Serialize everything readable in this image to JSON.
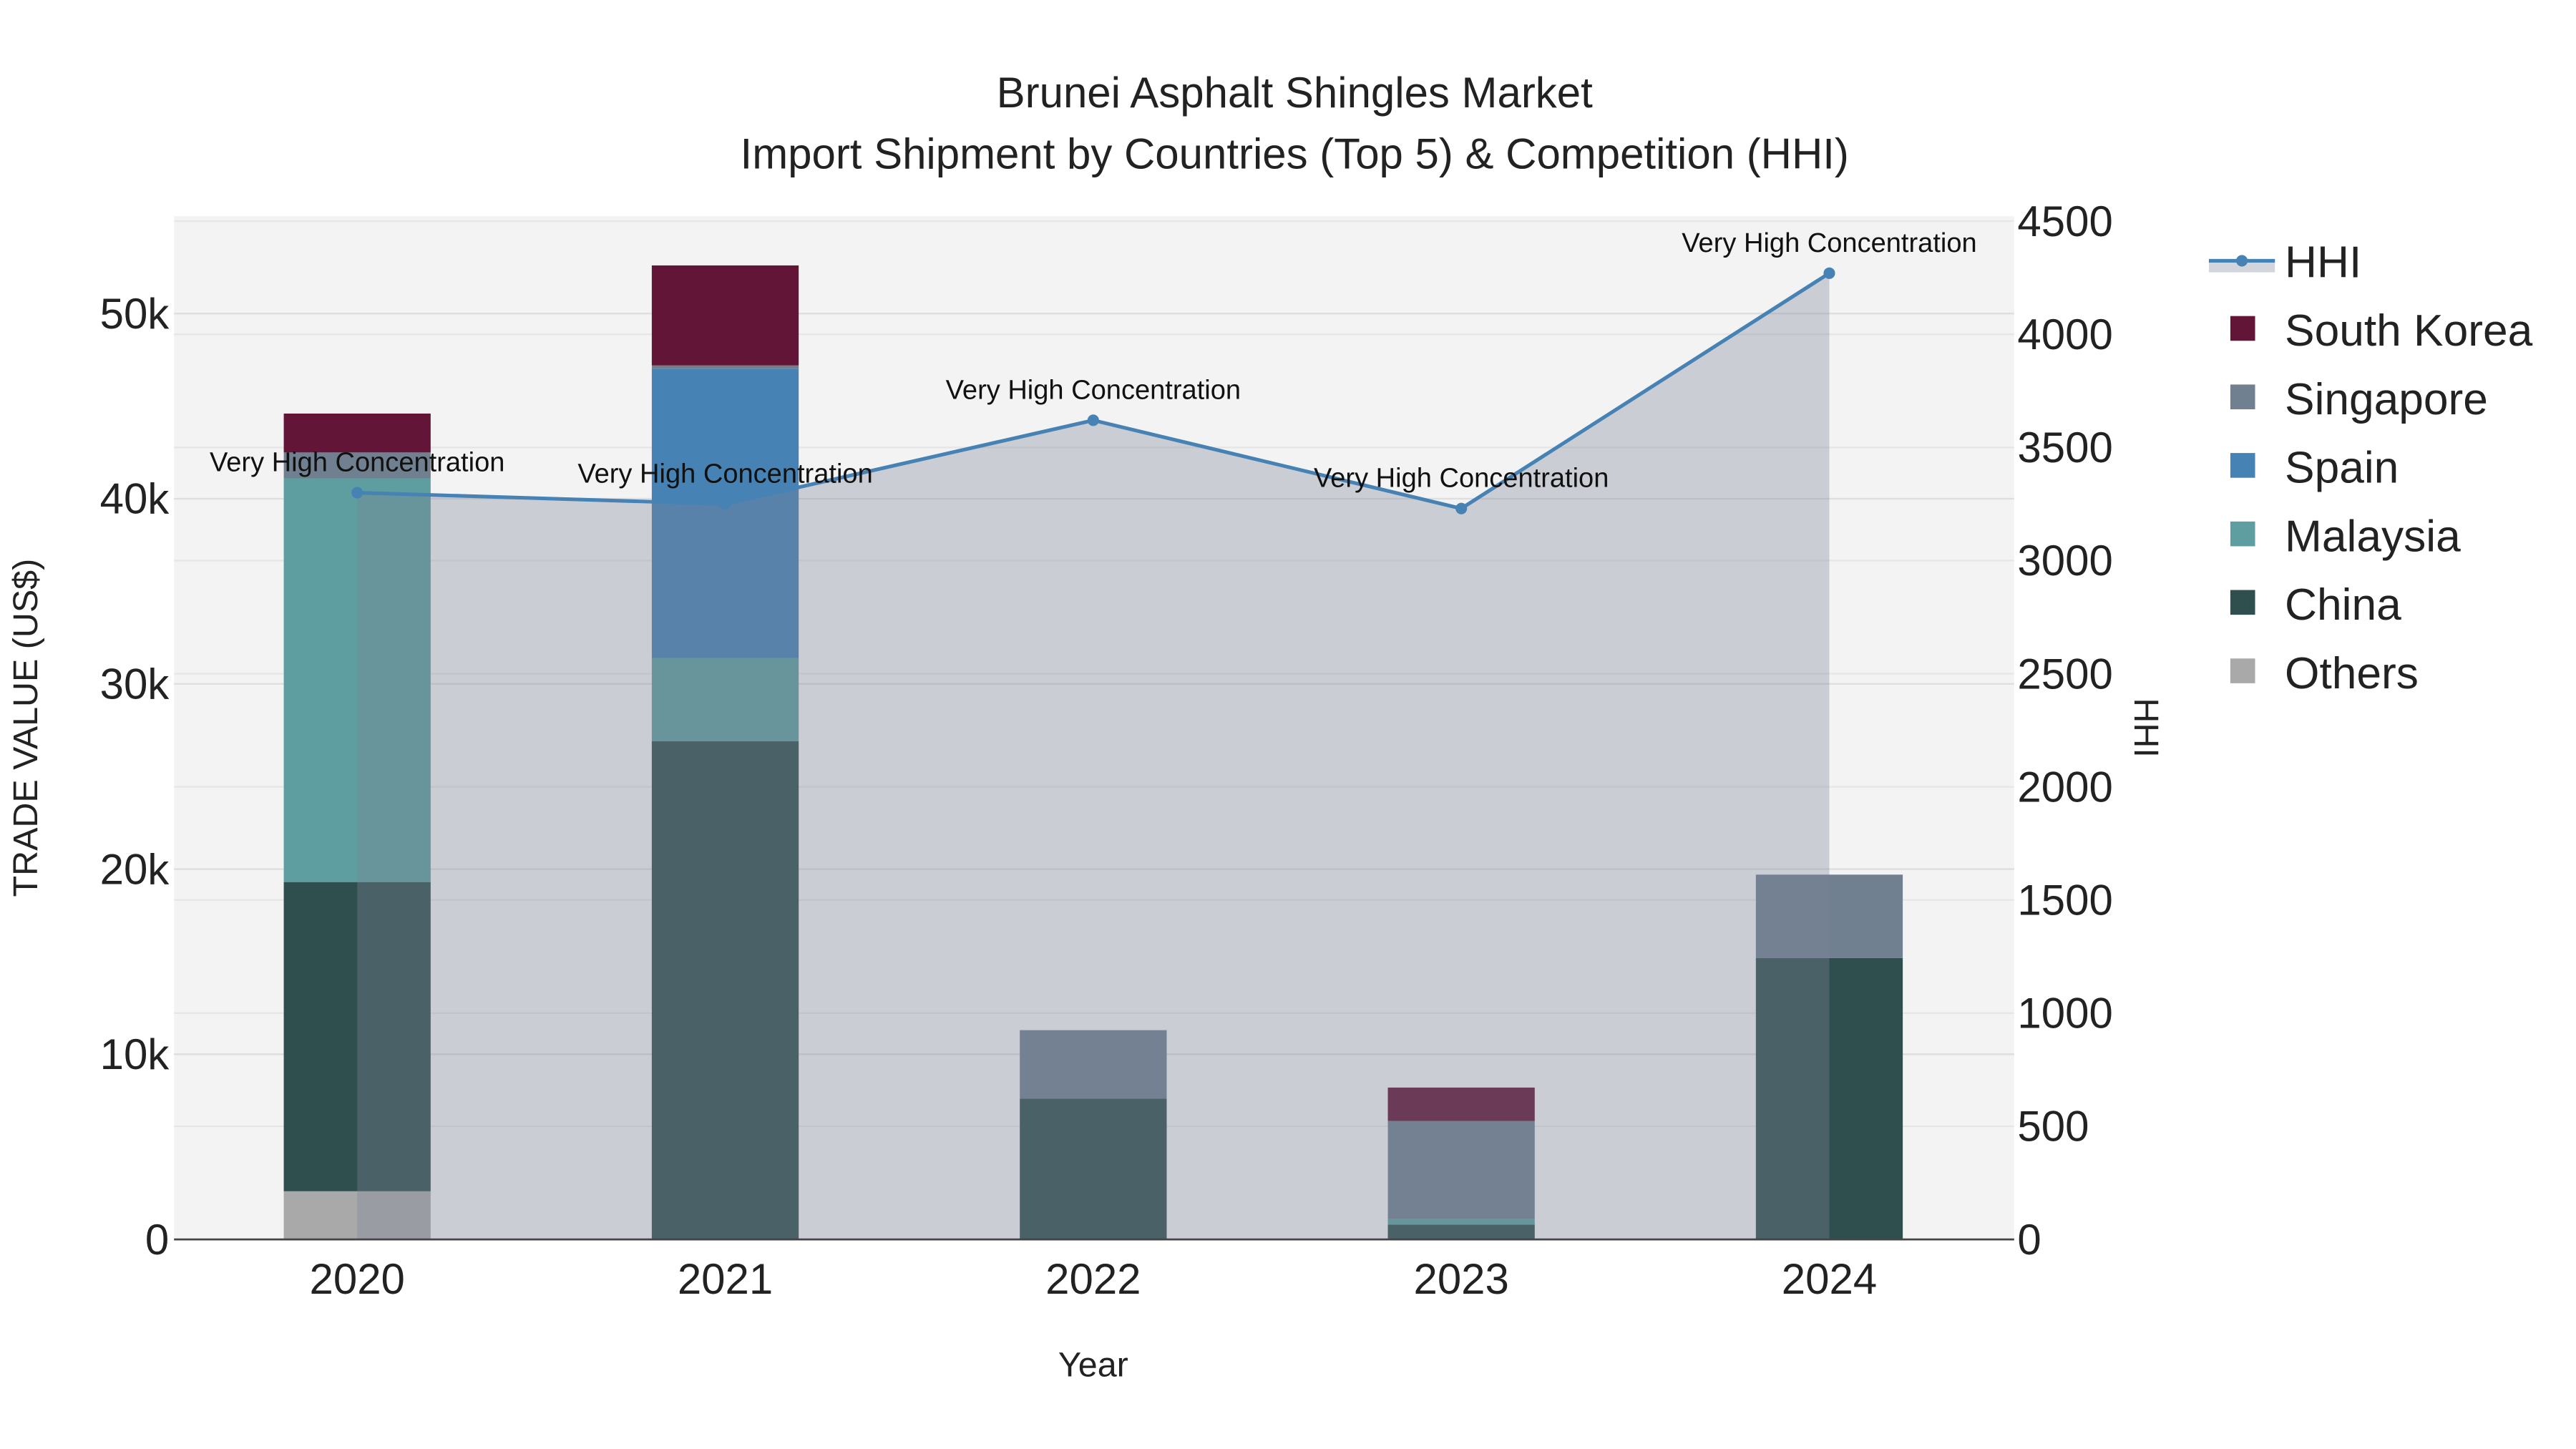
{
  "chart_data": {
    "type": "bar",
    "title": "Brunei Asphalt Shingles Market",
    "subtitle": "Import Shipment by Countries (Top 5) & Competition (HHI)",
    "xlabel": "Year",
    "ylabel": "TRADE VALUE (US$)",
    "y2label": "HHI",
    "categories": [
      "2020",
      "2021",
      "2022",
      "2023",
      "2024"
    ],
    "ylim": [
      0,
      55000
    ],
    "y2lim": [
      0,
      4500
    ],
    "yticks": [
      0,
      10000,
      20000,
      30000,
      40000,
      50000
    ],
    "ytick_labels": [
      "0",
      "10k",
      "20k",
      "30k",
      "40k",
      "50k"
    ],
    "y2ticks": [
      0,
      500,
      1000,
      1500,
      2000,
      2500,
      3000,
      3500,
      4000,
      4500
    ],
    "y2tick_labels": [
      "0",
      "500",
      "1000",
      "1500",
      "2000",
      "2500",
      "3000",
      "3500",
      "4000",
      "4500"
    ],
    "series": [
      {
        "name": "Others",
        "color": "#a9a9a9",
        "values": [
          2600,
          0,
          0,
          0,
          0
        ]
      },
      {
        "name": "China",
        "color": "#2f4f4f",
        "values": [
          16700,
          26900,
          7600,
          800,
          15200
        ]
      },
      {
        "name": "Malaysia",
        "color": "#5f9ea0",
        "values": [
          21800,
          4500,
          0,
          300,
          0
        ]
      },
      {
        "name": "Spain",
        "color": "#4682b4",
        "values": [
          0,
          15600,
          0,
          0,
          0
        ]
      },
      {
        "name": "Singapore",
        "color": "#708090",
        "values": [
          1400,
          200,
          3700,
          5300,
          4500
        ]
      },
      {
        "name": "South Korea",
        "color": "#631537",
        "values": [
          2100,
          5400,
          0,
          1800,
          0
        ]
      }
    ],
    "hhi": {
      "name": "HHI",
      "color": "#4682b4",
      "values": [
        3300,
        3250,
        3620,
        3230,
        4270
      ],
      "annotations": [
        "Very High Concentration",
        "Very High Concentration",
        "Very High Concentration",
        "Very High Concentration",
        "Very High Concentration"
      ]
    },
    "legend_order": [
      "HHI",
      "South Korea",
      "Singapore",
      "Spain",
      "Malaysia",
      "China",
      "Others"
    ],
    "legend_position": "right",
    "grid": true
  }
}
